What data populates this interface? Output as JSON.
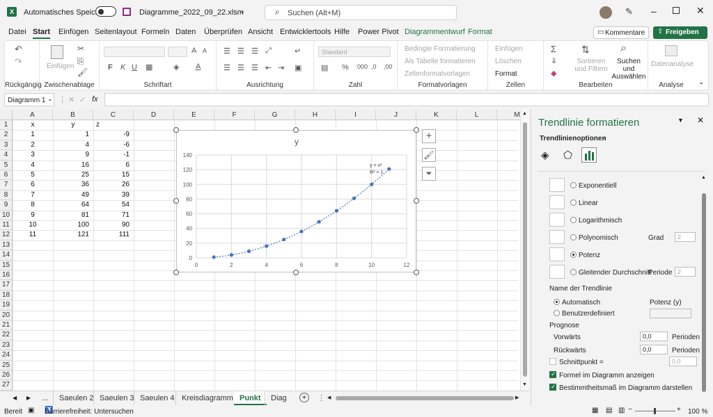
{
  "window": {
    "autosave_label": "Automatisches Speichern",
    "file_name": "Diagramme_2022_09_22.xlsm",
    "search_placeholder": "Suchen (Alt+M)"
  },
  "ribbon_tabs": [
    "Datei",
    "Start",
    "Einfügen",
    "Seitenlayout",
    "Formeln",
    "Daten",
    "Überprüfen",
    "Ansicht",
    "Entwicklertools",
    "Hilfe",
    "Power Pivot",
    "Diagrammentwurf",
    "Format"
  ],
  "header_buttons": {
    "comments": "Kommentare",
    "share": "Freigeben"
  },
  "ribbon": {
    "undo_group": "Rückgängig",
    "clipboard_group": "Zwischenablage",
    "paste_label": "Einfügen",
    "font_group": "Schriftart",
    "alignment_group": "Ausrichtung",
    "number_group": "Zahl",
    "number_format": "Standard",
    "styles_group": "Formatvorlagen",
    "styles_items": [
      "Bedingte Formatierung",
      "Als Tabelle formatieren",
      "Zellenformatvorlagen"
    ],
    "cells_group": "Zellen",
    "cells_items": [
      "Einfügen",
      "Löschen",
      "Format"
    ],
    "edit_group": "Bearbeiten",
    "sort_label": "Sortieren und Filtern",
    "find_label": "Suchen und Auswählen",
    "analysis_group": "Analyse",
    "data_analysis": "Datenanalyse"
  },
  "formula_bar": {
    "name_box": "Diagramm 1",
    "fx": "fx"
  },
  "columns": [
    "A",
    "B",
    "C",
    "D",
    "E",
    "F",
    "G",
    "H",
    "I",
    "J",
    "K",
    "L",
    "M"
  ],
  "rows": [
    "1",
    "2",
    "3",
    "4",
    "5",
    "6",
    "7",
    "8",
    "9",
    "10",
    "11",
    "12",
    "13",
    "14",
    "15",
    "16",
    "17",
    "18",
    "19",
    "20",
    "21",
    "22",
    "23",
    "24",
    "25",
    "26",
    "27"
  ],
  "table": {
    "headers": [
      "x",
      "y",
      "z"
    ],
    "rows": [
      [
        "1",
        "1",
        "-9"
      ],
      [
        "2",
        "4",
        "-6"
      ],
      [
        "3",
        "9",
        "-1"
      ],
      [
        "4",
        "16",
        "6"
      ],
      [
        "5",
        "25",
        "15"
      ],
      [
        "6",
        "36",
        "26"
      ],
      [
        "7",
        "49",
        "39"
      ],
      [
        "8",
        "64",
        "54"
      ],
      [
        "9",
        "81",
        "71"
      ],
      [
        "10",
        "100",
        "90"
      ],
      [
        "11",
        "121",
        "111"
      ]
    ]
  },
  "chart_data": {
    "type": "scatter",
    "title": "y",
    "x": [
      1,
      2,
      3,
      4,
      5,
      6,
      7,
      8,
      9,
      10,
      11
    ],
    "y": [
      1,
      4,
      9,
      16,
      25,
      36,
      49,
      64,
      81,
      100,
      121
    ],
    "xlim": [
      0,
      12
    ],
    "ylim": [
      0,
      140
    ],
    "xticks": [
      "0",
      "2",
      "4",
      "6",
      "8",
      "10",
      "12"
    ],
    "yticks": [
      "0",
      "20",
      "40",
      "60",
      "80",
      "100",
      "120",
      "140"
    ],
    "trendline": {
      "type": "power",
      "equation": "y = x²",
      "r2": "R² = 1"
    },
    "grid": true,
    "color": "#4472c4"
  },
  "sheet_tabs": [
    "...",
    "Saeulen 2",
    "Saeulen 3",
    "Saeulen 4",
    "Kreisdiagramm",
    "Punkt",
    "Diag"
  ],
  "active_sheet": "Punkt",
  "status": {
    "ready": "Bereit",
    "accessibility": "Barrierefreiheit: Untersuchen",
    "zoom": "100 %"
  },
  "pane": {
    "title": "Trendlinie formatieren",
    "section": "Trendlinienoptionen",
    "types": [
      "Exponentiell",
      "Linear",
      "Logarithmisch",
      "Polynomisch",
      "Potenz",
      "Gleitender Durchschnitt"
    ],
    "selected_type": "Potenz",
    "grad_label": "Grad",
    "grad_value": "2",
    "periode_label": "Periode",
    "periode_value": "2",
    "name_heading": "Name der Trendlinie",
    "name_auto": "Automatisch",
    "name_auto_value": "Potenz (y)",
    "name_custom": "Benutzerdefiniert",
    "forecast_heading": "Prognose",
    "forward_label": "Vorwärts",
    "forward_value": "0,0",
    "backward_label": "Rückwärts",
    "backward_value": "0,0",
    "periods_unit": "Perioden",
    "intercept_label": "Schnittpunkt =",
    "intercept_value": "0,0",
    "show_equation": "Formel im Diagramm anzeigen",
    "show_r2": "Bestimmtheitsmaß im Diagramm darstellen"
  }
}
